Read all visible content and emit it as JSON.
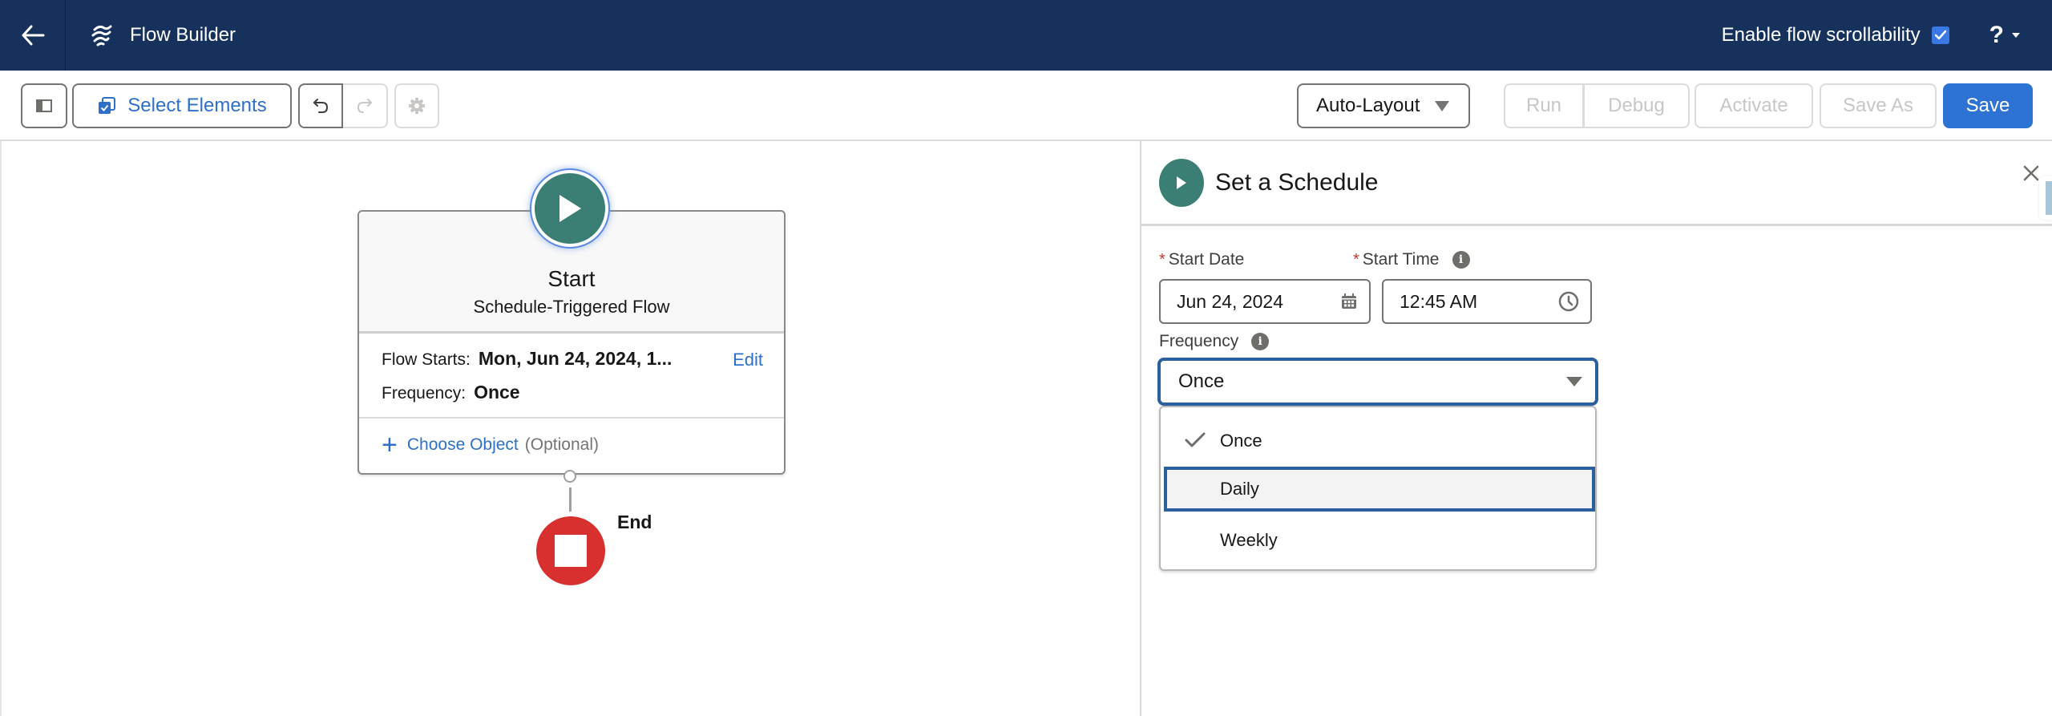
{
  "header": {
    "app_title": "Flow Builder",
    "back_icon": "arrow-left-icon",
    "brand_icon": "flow-icon",
    "scrollability_label": "Enable flow scrollability",
    "scrollability_checked": true,
    "help_label": "?",
    "colors": {
      "background": "#16325c",
      "checkbox": "#3a78e6"
    }
  },
  "toolbar": {
    "toggle_panel_icon": "panel-toggle-icon",
    "select_elements_label": "Select Elements",
    "undo_icon": "undo-icon",
    "redo_icon": "redo-icon",
    "settings_icon": "gear-icon",
    "layout_mode": "Auto-Layout",
    "run_label": "Run",
    "debug_label": "Debug",
    "activate_label": "Activate",
    "save_as_label": "Save As",
    "save_label": "Save",
    "colors": {
      "primary": "#2e73d3",
      "link": "#2e6fc9"
    }
  },
  "canvas": {
    "start_node": {
      "title": "Start",
      "subtitle": "Schedule-Triggered Flow",
      "flow_starts_label": "Flow Starts:",
      "flow_starts_value": "Mon, Jun 24, 2024, 1...",
      "frequency_label": "Frequency:",
      "frequency_value": "Once",
      "edit_label": "Edit",
      "choose_object_label": "Choose Object",
      "optional_label": "(Optional)",
      "icon_color": "#3b7f74"
    },
    "end_node": {
      "label": "End",
      "icon_color": "#d8302f"
    }
  },
  "panel": {
    "title": "Set a Schedule",
    "start_date": {
      "label": "Start Date",
      "required": "*",
      "value": "Jun 24, 2024"
    },
    "start_time": {
      "label": "Start Time",
      "required": "*",
      "value": "12:45 AM"
    },
    "frequency": {
      "label": "Frequency",
      "selected": "Once",
      "options": [
        {
          "label": "Once",
          "checked": true,
          "highlighted": false
        },
        {
          "label": "Daily",
          "checked": false,
          "highlighted": true
        },
        {
          "label": "Weekly",
          "checked": false,
          "highlighted": false
        }
      ]
    },
    "info_glyph": "i"
  }
}
